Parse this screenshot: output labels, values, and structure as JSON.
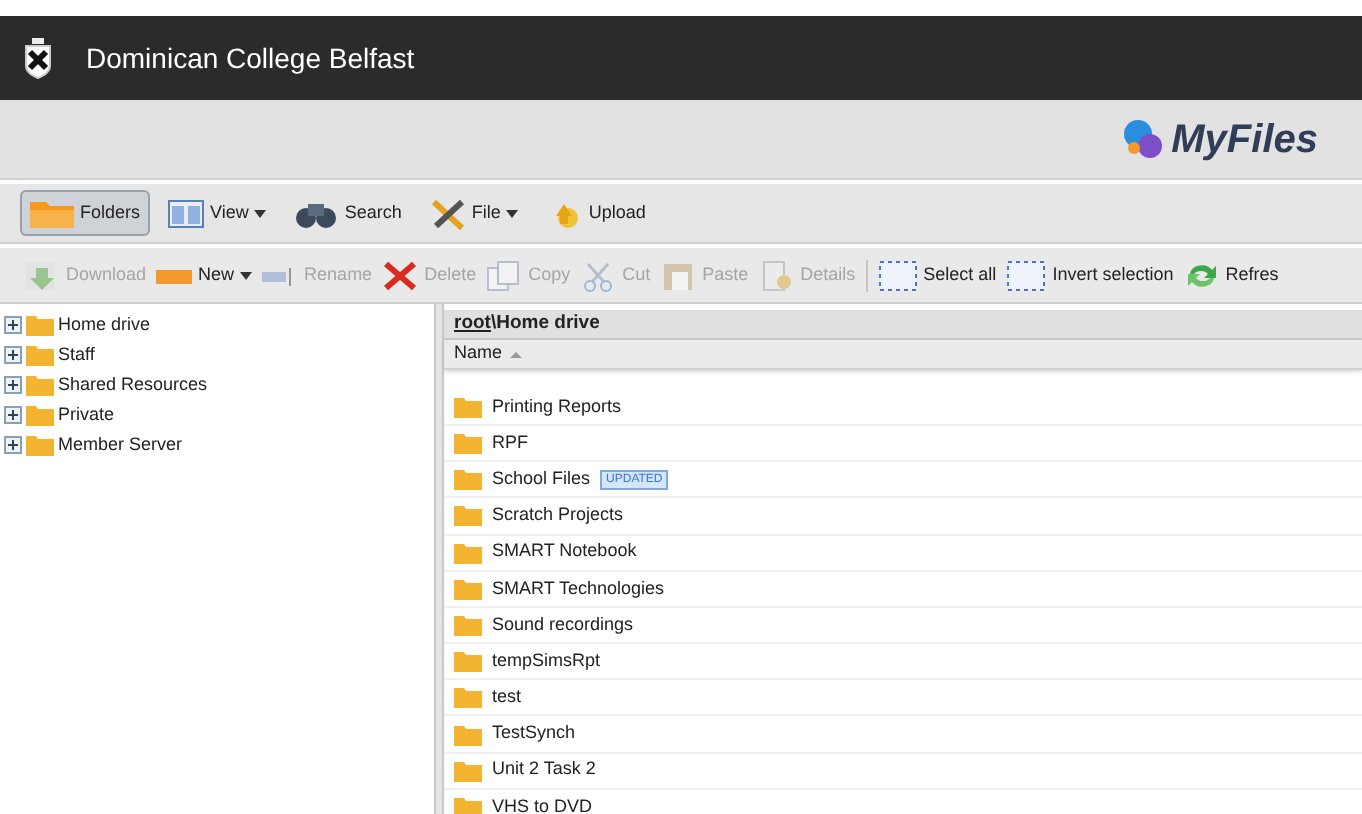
{
  "header": {
    "title": "Dominican College Belfast"
  },
  "brand": {
    "logo_text": "MyFiles"
  },
  "main_toolbar": [
    {
      "label": "Folders",
      "kind": "folder",
      "selected": true,
      "dropdown": false
    },
    {
      "label": "View",
      "kind": "view",
      "selected": false,
      "dropdown": true
    },
    {
      "label": "Search",
      "kind": "binoculars",
      "selected": false,
      "dropdown": false
    },
    {
      "label": "File",
      "kind": "tools",
      "selected": false,
      "dropdown": true
    },
    {
      "label": "Upload",
      "kind": "upload",
      "selected": false,
      "dropdown": false
    }
  ],
  "action_toolbar": [
    {
      "label": "Download",
      "kind": "download",
      "disabled": true,
      "dropdown": false
    },
    {
      "label": "New",
      "kind": "new",
      "disabled": false,
      "dropdown": true
    },
    {
      "label": "Rename",
      "kind": "rename",
      "disabled": true,
      "dropdown": false
    },
    {
      "label": "Delete",
      "kind": "delete",
      "disabled": true,
      "dropdown": false
    },
    {
      "label": "Copy",
      "kind": "copy",
      "disabled": true,
      "dropdown": false
    },
    {
      "label": "Cut",
      "kind": "cut",
      "disabled": true,
      "dropdown": false
    },
    {
      "label": "Paste",
      "kind": "paste",
      "disabled": true,
      "dropdown": false
    },
    {
      "label": "Details",
      "kind": "details",
      "disabled": true,
      "dropdown": false
    },
    {
      "kind": "separator"
    },
    {
      "label": "Select all",
      "kind": "select",
      "disabled": false,
      "dropdown": false
    },
    {
      "label": "Invert selection",
      "kind": "select",
      "disabled": false,
      "dropdown": false
    },
    {
      "label": "Refres",
      "kind": "refresh",
      "disabled": false,
      "dropdown": false
    }
  ],
  "tree": [
    {
      "label": "Home drive",
      "expanded": false
    },
    {
      "label": "Staff",
      "expanded": false
    },
    {
      "label": "Shared Resources",
      "expanded": false
    },
    {
      "label": "Private",
      "expanded": false
    },
    {
      "label": "Member Server",
      "expanded": false
    }
  ],
  "file_list": {
    "path": {
      "root": "root",
      "rest": "\\Home drive"
    },
    "columns": [
      {
        "label": "Name",
        "sorted_ascending": true
      }
    ],
    "rows": [
      {
        "name": "Printing Reports"
      },
      {
        "name": "RPF"
      },
      {
        "name": "School Files",
        "badge": "UPDATED"
      },
      {
        "name": "Scratch Projects"
      },
      {
        "name": "SMART Notebook"
      },
      {
        "name": "SMART Technologies"
      },
      {
        "name": "Sound recordings"
      },
      {
        "name": "tempSimsRpt"
      },
      {
        "name": "test"
      },
      {
        "name": "TestSynch"
      },
      {
        "name": "Unit 2 Task 2"
      },
      {
        "name": "VHS to DVD"
      }
    ]
  }
}
